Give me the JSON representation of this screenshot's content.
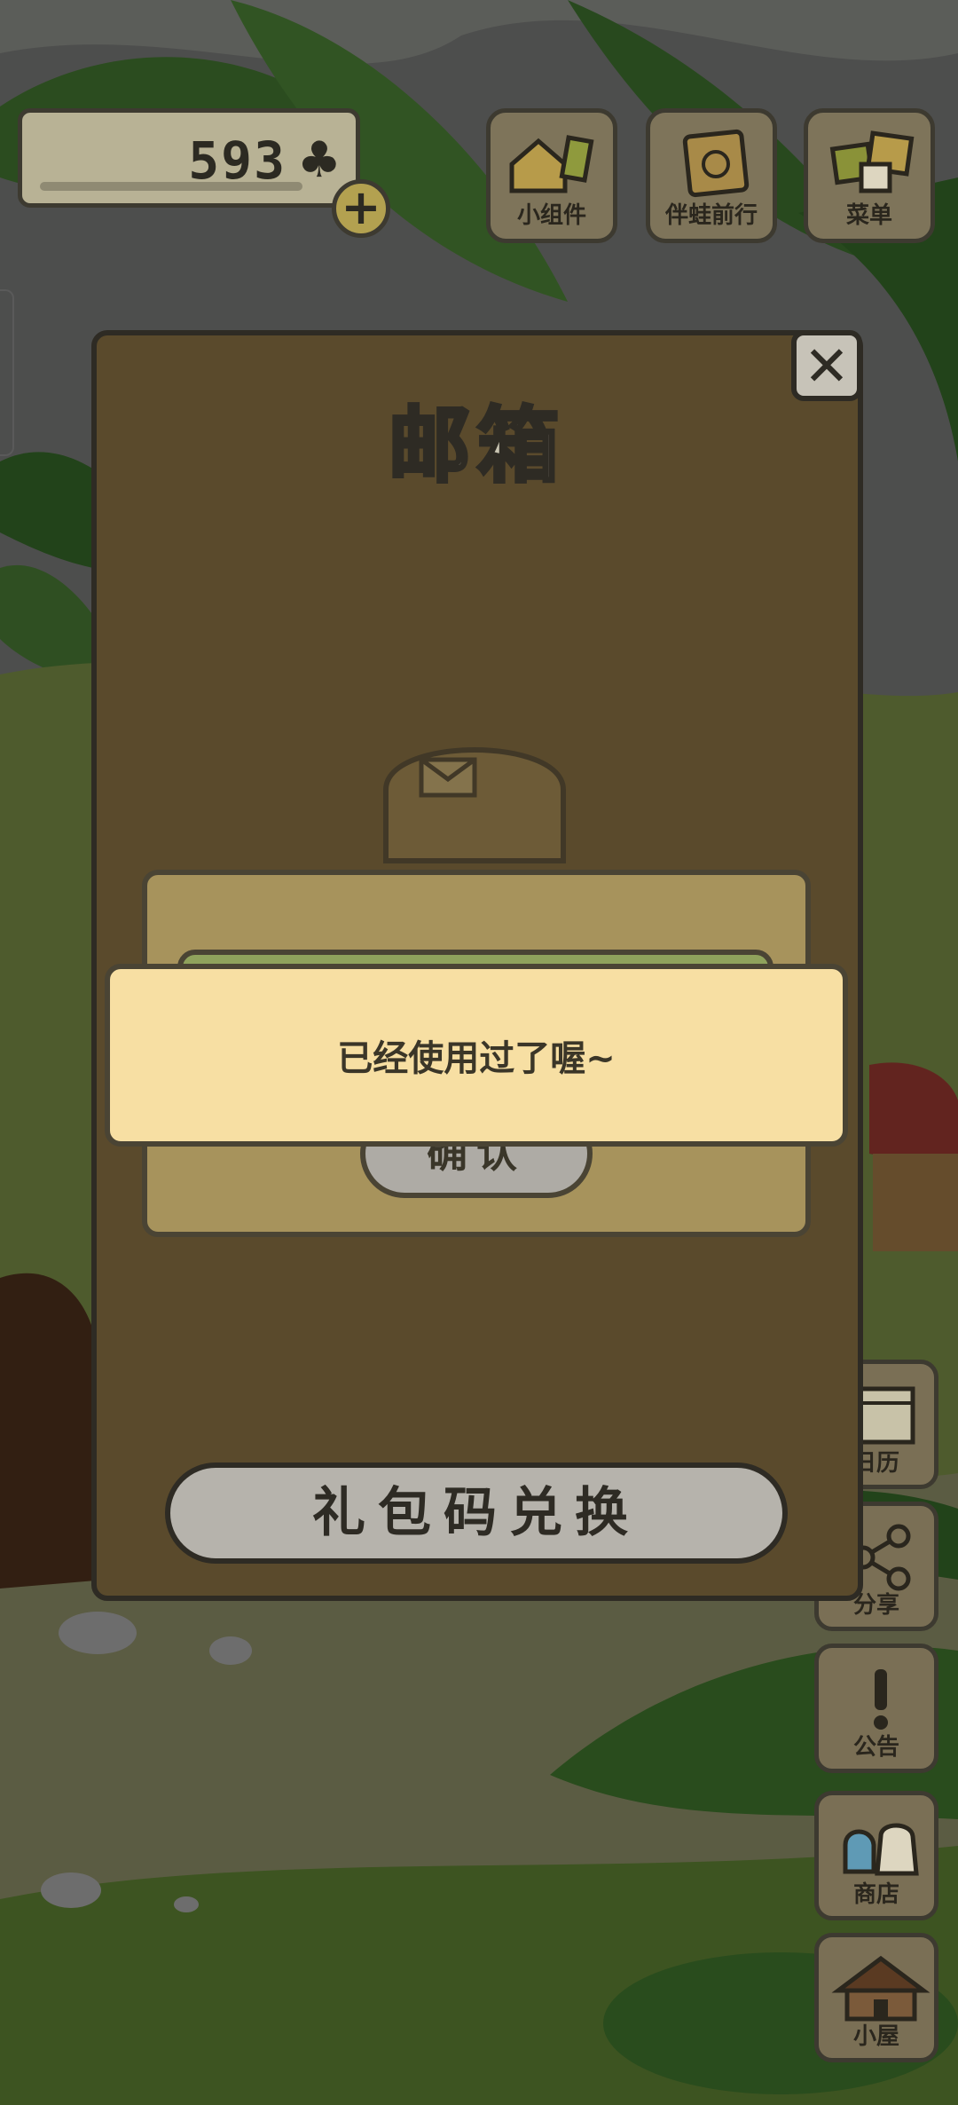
{
  "hud": {
    "clover_count": "593",
    "clover_icon": "clover-icon",
    "plus_icon": "plus-icon"
  },
  "top_buttons": [
    {
      "label": "小组件",
      "icon": "widget-icon"
    },
    {
      "label": "伴蛙前行",
      "icon": "frog-book-icon"
    },
    {
      "label": "菜单",
      "icon": "menu-icon"
    }
  ],
  "side_buttons": [
    {
      "label": "日历",
      "icon": "calendar-icon"
    },
    {
      "label": "分享",
      "icon": "share-icon"
    },
    {
      "label": "公告",
      "icon": "exclamation-icon"
    },
    {
      "label": "商店",
      "icon": "shop-bags-icon"
    },
    {
      "label": "小屋",
      "icon": "house-icon"
    }
  ],
  "mailbox": {
    "title": "邮箱",
    "close_icon": "close-icon",
    "redeem_label": "礼包码兑换"
  },
  "dialog": {
    "confirm_label": "确认"
  },
  "toast": {
    "message": "已经使用过了喔~"
  }
}
